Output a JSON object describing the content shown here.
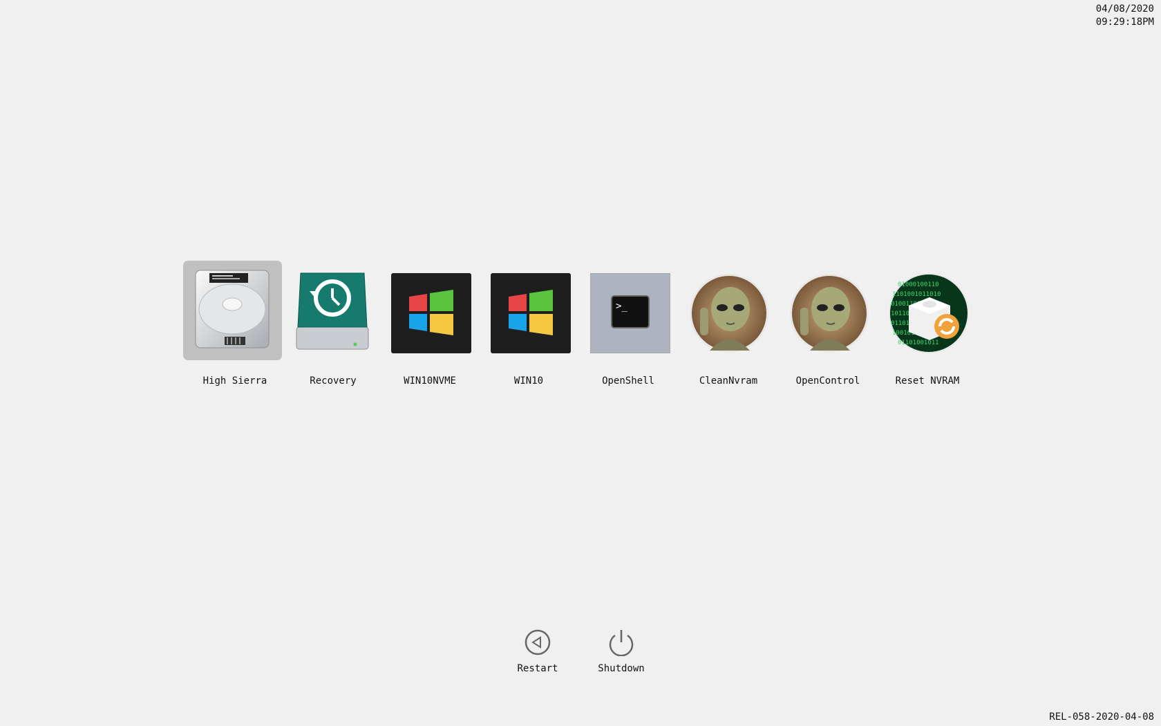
{
  "clock": {
    "date": "04/08/2020",
    "time": "09:29:18PM"
  },
  "version": "REL-058-2020-04-08",
  "entries": [
    {
      "label": "High Sierra",
      "icon": "hard-drive-icon",
      "selected": true
    },
    {
      "label": "Recovery",
      "icon": "time-machine-recovery-icon",
      "selected": false
    },
    {
      "label": "WIN10NVME",
      "icon": "windows-logo-icon",
      "selected": false
    },
    {
      "label": "WIN10",
      "icon": "windows-logo-icon",
      "selected": false
    },
    {
      "label": "OpenShell",
      "icon": "terminal-icon",
      "selected": false
    },
    {
      "label": "CleanNvram",
      "icon": "alien-icon",
      "selected": false
    },
    {
      "label": "OpenControl",
      "icon": "alien-icon",
      "selected": false
    },
    {
      "label": "Reset NVRAM",
      "icon": "reset-nvram-icon",
      "selected": false
    }
  ],
  "tools": {
    "restart": {
      "label": "Restart",
      "icon": "restart-icon"
    },
    "shutdown": {
      "label": "Shutdown",
      "icon": "power-icon"
    }
  },
  "colors": {
    "background": "#f0f0f0",
    "selection": "#c0c0c0",
    "windows_red": "#e64545",
    "windows_green": "#5ac43e",
    "windows_blue": "#19a3e8",
    "windows_yellow": "#f5c842",
    "recovery_teal": "#167a6e"
  }
}
